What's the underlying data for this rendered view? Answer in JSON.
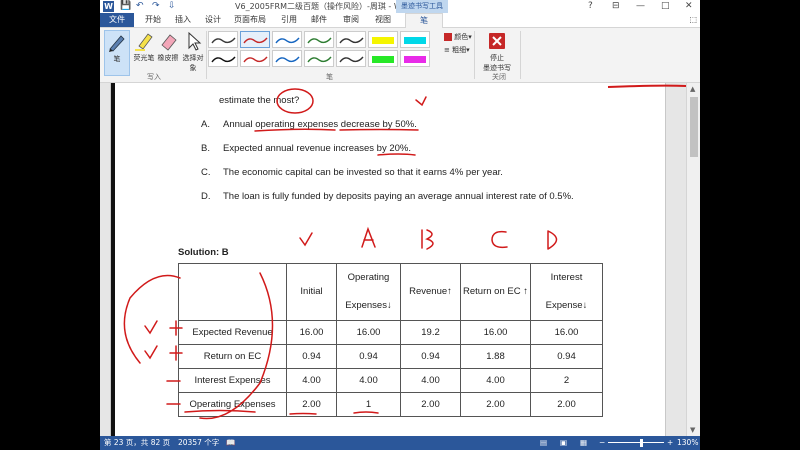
{
  "window": {
    "title": "V6_2005FRM二级百题（操作风险）-周琪 - Word",
    "minimize": "—",
    "maximize": "□",
    "close": "✕"
  },
  "quick_access": {
    "save": "💾",
    "undo": "↶",
    "redo": "↷",
    "more": "⇩"
  },
  "tabs": [
    {
      "label": "文件"
    },
    {
      "label": "开始"
    },
    {
      "label": "插入"
    },
    {
      "label": "设计"
    },
    {
      "label": "页面布局"
    },
    {
      "label": "引用"
    },
    {
      "label": "邮件"
    },
    {
      "label": "审阅"
    },
    {
      "label": "视图"
    },
    {
      "label": "笔"
    }
  ],
  "context_tab_label": "墨迹书写工具",
  "ribbon": {
    "pen_button": "笔",
    "highlighter_button": "荧光笔",
    "eraser_button": "橡皮擦",
    "select_button": "选择对象",
    "write_group": "写入",
    "pens_group": "笔",
    "color_label": "颜色",
    "thickness_label": "粗细",
    "stop_ink_line1": "停止",
    "stop_ink_line2": "墨迹书写",
    "close_group": "关闭",
    "pen_colors": [
      "#3a3a3a",
      "#c62828",
      "#1565c0",
      "#2e7d32",
      "#333333",
      "#f5f500",
      "#00d8e8",
      "#111111",
      "#c62828",
      "#1565c0",
      "#2e7d32",
      "#333333",
      "#27e827",
      "#e82be8"
    ]
  },
  "document": {
    "question_tail": "estimate the most?",
    "options": [
      {
        "letter": "A.",
        "text": "Annual operating expenses decrease by 50%."
      },
      {
        "letter": "B.",
        "text": "Expected annual revenue increases by 20%."
      },
      {
        "letter": "C.",
        "text": "The economic capital can be invested so that it earns 4% per year."
      },
      {
        "letter": "D.",
        "text": "The loan is fully funded by deposits paying an average annual interest rate of 0.5%."
      }
    ],
    "solution_label": "Solution: B",
    "table": {
      "headers": [
        "",
        "Initial",
        "Operating Expenses↓",
        "Revenue↑",
        "Return on EC ↑",
        "Interest Expense↓"
      ],
      "rows": [
        [
          "Expected Revenue",
          "16.00",
          "16.00",
          "19.2",
          "16.00",
          "16.00"
        ],
        [
          "Return on EC",
          "0.94",
          "0.94",
          "0.94",
          "1.88",
          "0.94"
        ],
        [
          "Interest Expenses",
          "4.00",
          "4.00",
          "4.00",
          "4.00",
          "2"
        ],
        [
          "Operating Expenses",
          "2.00",
          "1",
          "2.00",
          "2.00",
          "2.00"
        ]
      ]
    }
  },
  "status": {
    "page": "第 23 页，共 82 页",
    "words": "20357 个字",
    "zoom": "130%",
    "zoom_minus": "−",
    "zoom_plus": "+"
  }
}
